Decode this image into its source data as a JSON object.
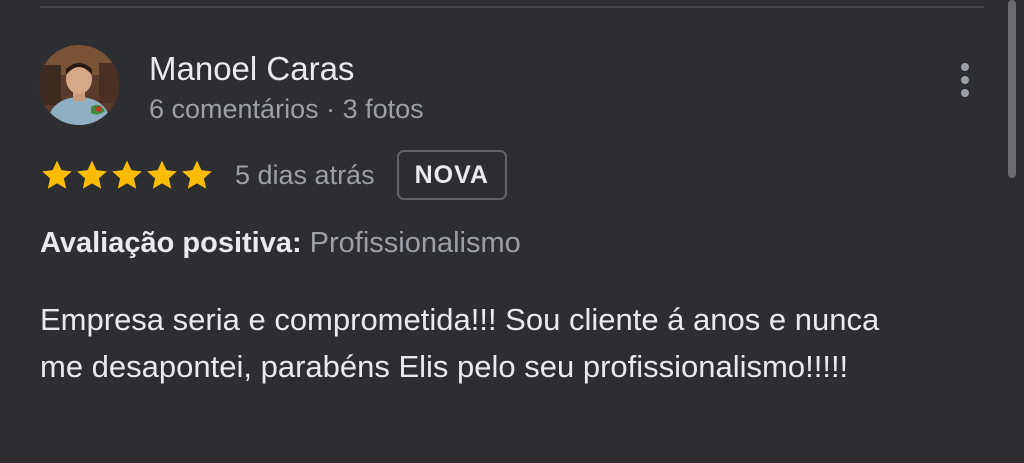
{
  "review": {
    "author": "Manoel Caras",
    "author_meta": "6 comentários · 3 fotos",
    "rating": 5,
    "rating_max": 5,
    "date": "5 dias atrás",
    "badge": "NOVA",
    "positive_label": "Avaliação positiva:",
    "positive_value": "Profissionalismo",
    "text": "Empresa seria e comprometida!!! Sou cliente á anos e nunca me desapontei, parabéns Elis pelo seu profissionalismo!!!!!"
  },
  "icons": {
    "more": "more-vertical-icon",
    "star": "star-icon",
    "avatar": "avatar-photo"
  },
  "colors": {
    "background": "#2d2e31",
    "star": "#fbbc04",
    "primary_text": "#e8eaed",
    "secondary_text": "#9aa0a6",
    "badge_border": "#5f6368"
  }
}
